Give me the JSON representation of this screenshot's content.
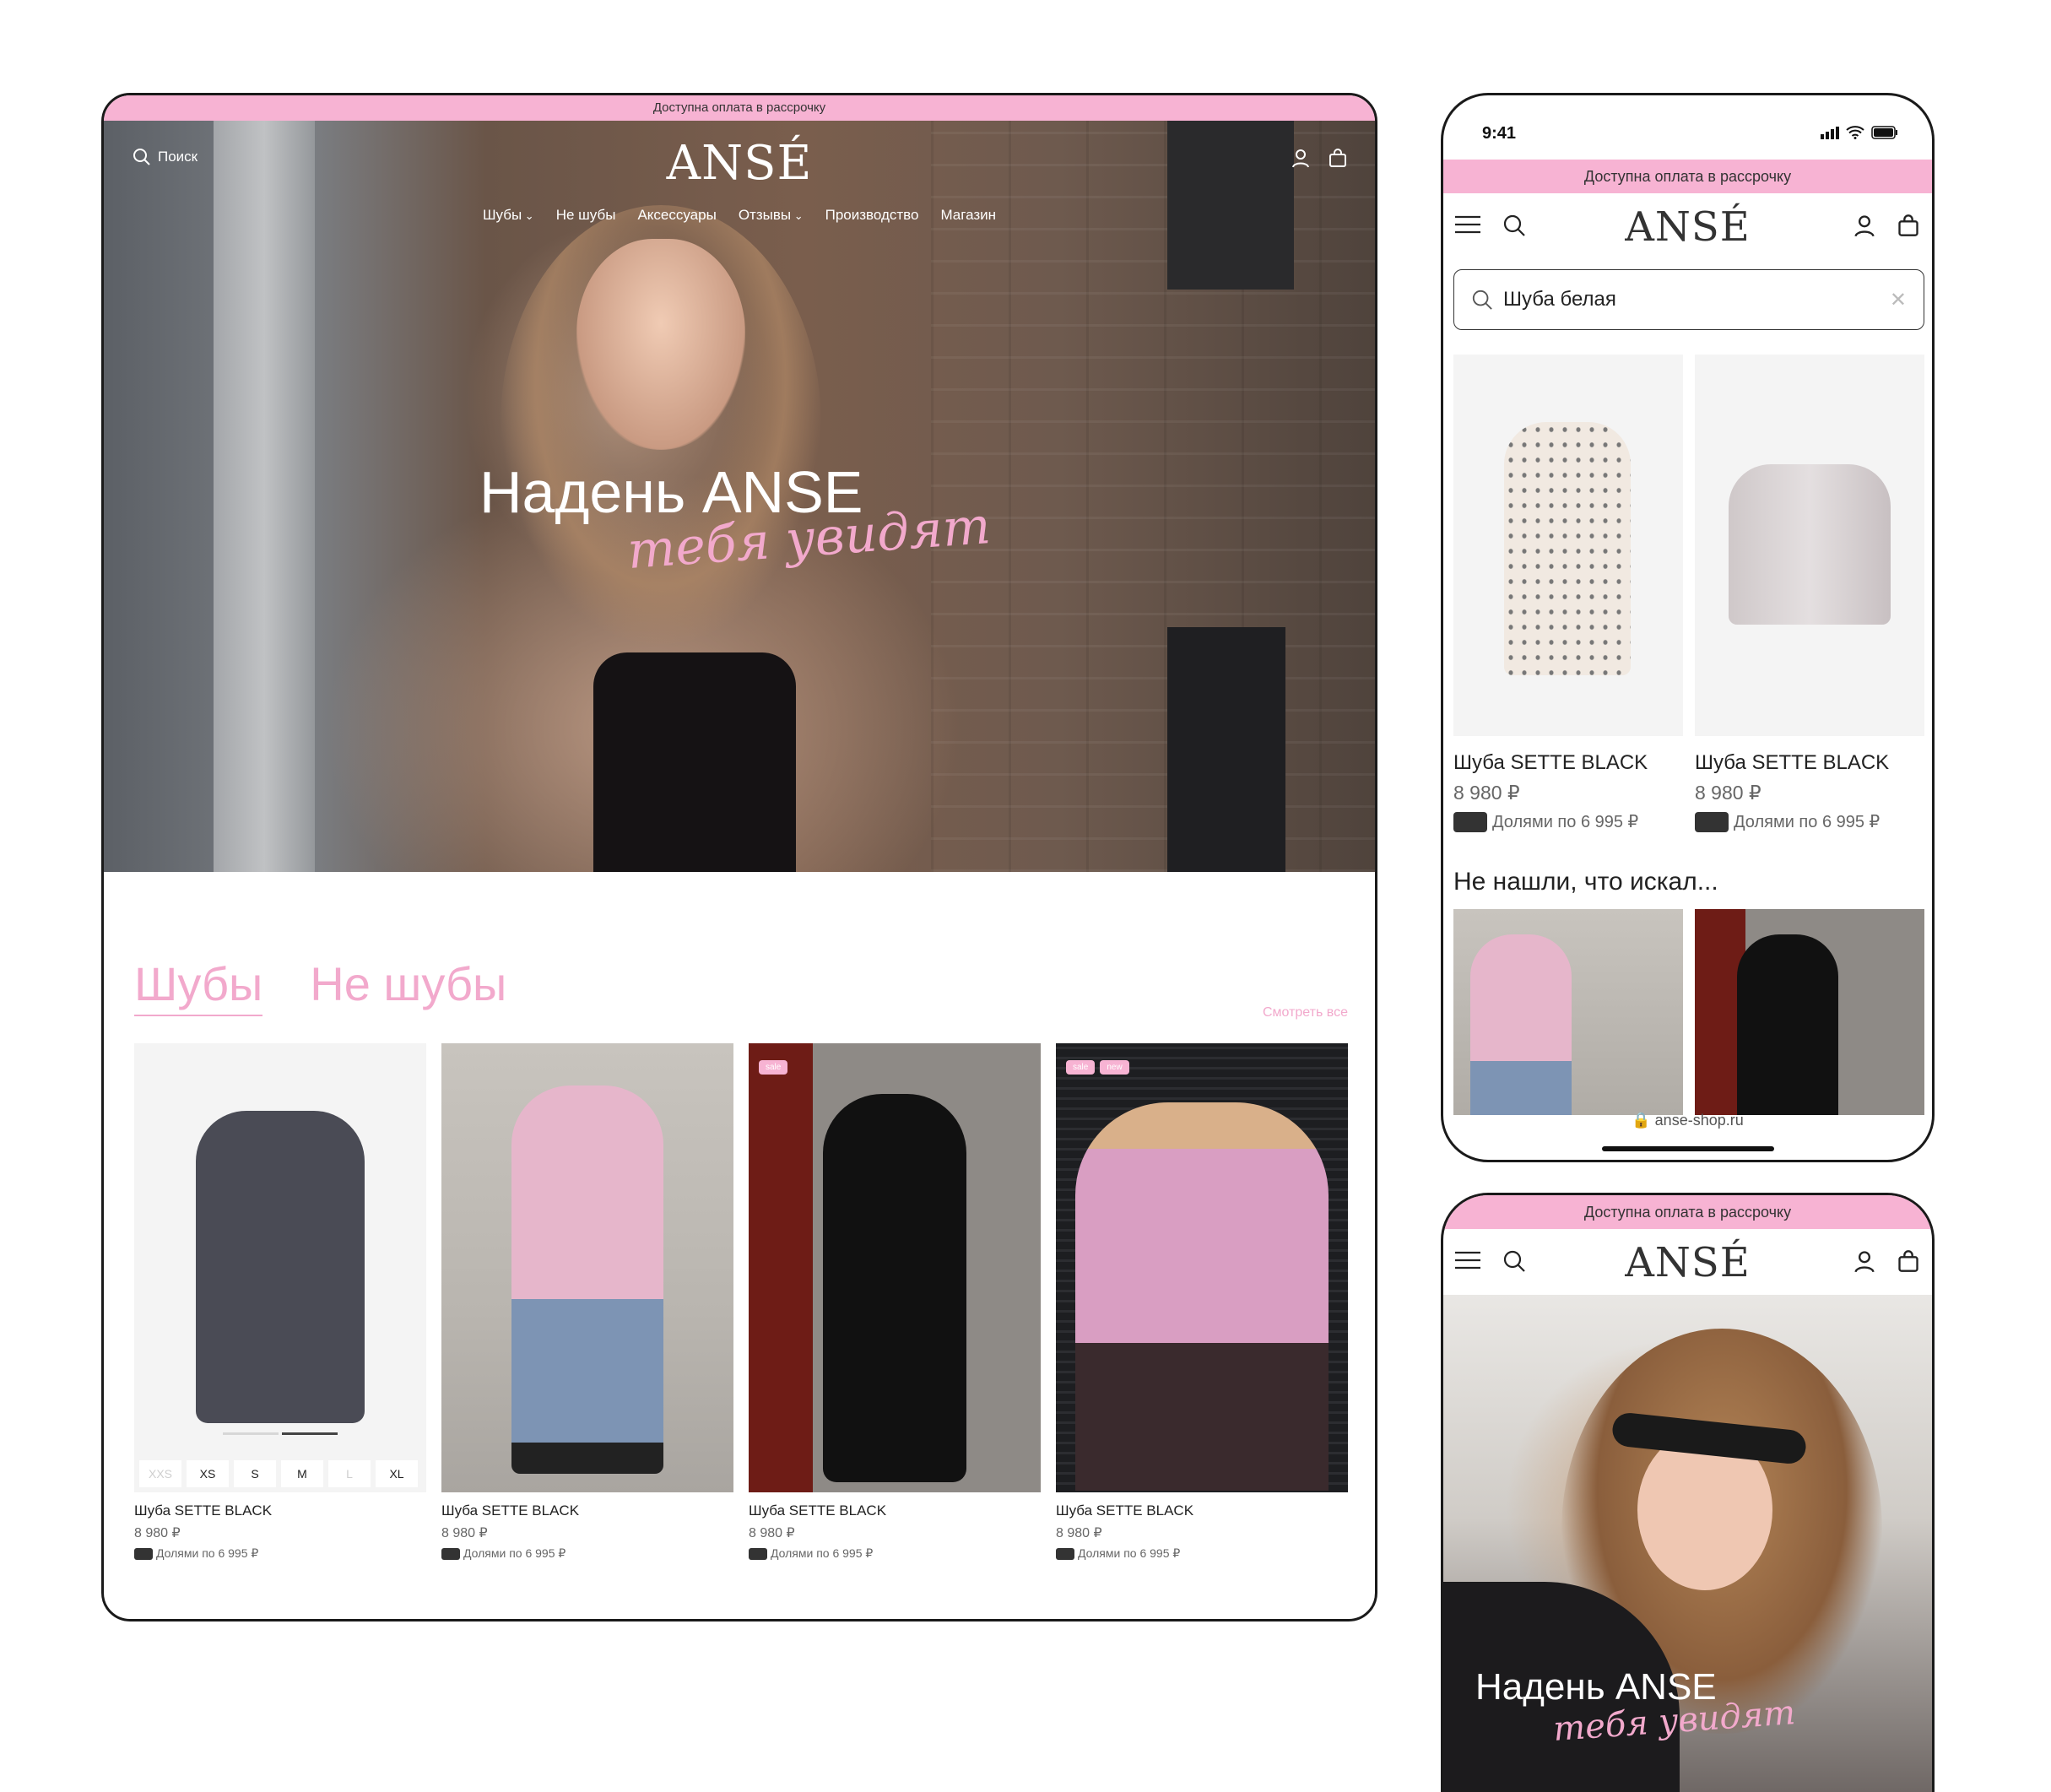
{
  "promo_text": "Доступна оплата в рассрочку",
  "brand": "ANSÉ",
  "desktop": {
    "search_label": "Поиск",
    "menu": [
      "Шубы",
      "Не шубы",
      "Аксессуары",
      "Отзывы",
      "Производство",
      "Магазин"
    ],
    "hero_title": "Надень ANSE",
    "hero_script": "тебя увидят",
    "tabs": [
      "Шубы",
      "Не шубы"
    ],
    "see_all": "Смотреть все",
    "products": [
      {
        "name": "Шуба SETTE BLACK",
        "price": "8 980 ₽",
        "split": "Долями по 6 995 ₽",
        "badges": []
      },
      {
        "name": "Шуба SETTE BLACK",
        "price": "8 980 ₽",
        "split": "Долями по 6 995 ₽",
        "badges": []
      },
      {
        "name": "Шуба SETTE BLACK",
        "price": "8 980 ₽",
        "split": "Долями по 6 995 ₽",
        "badges": [
          "sale"
        ]
      },
      {
        "name": "Шуба SETTE BLACK",
        "price": "8 980 ₽",
        "split": "Долями по 6 995 ₽",
        "badges": [
          "sale",
          "new"
        ]
      }
    ],
    "sizes": [
      "XXS",
      "XS",
      "S",
      "M",
      "L",
      "XL"
    ]
  },
  "phone_search": {
    "time": "9:41",
    "search_value": "Шуба белая",
    "results": [
      {
        "name": "Шуба SETTE BLACK",
        "price": "8 980 ₽",
        "split": "Долями по 6 995 ₽"
      },
      {
        "name": "Шуба SETTE BLACK",
        "price": "8 980 ₽",
        "split": "Долями по 6 995 ₽"
      }
    ],
    "not_found": "Не нашли, что искал...",
    "url": "anse-shop.ru"
  },
  "phone_home": {
    "hero_title": "Надень ANSE",
    "hero_script": "тебя увидят"
  },
  "colors": {
    "accent_pink": "#f7b3d3",
    "text_pink": "#f2a9cc"
  }
}
